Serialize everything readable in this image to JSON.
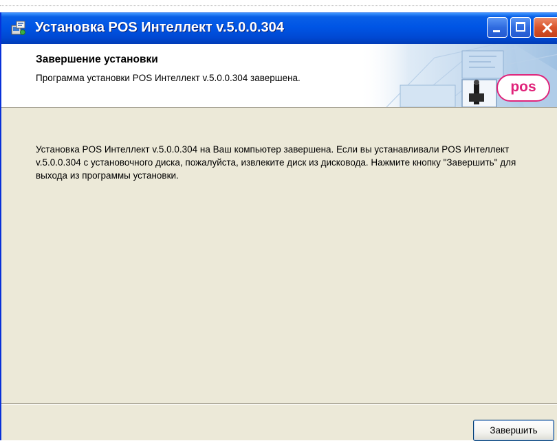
{
  "window": {
    "title": "Установка POS Интеллект v.5.0.0.304"
  },
  "header": {
    "title": "Завершение установки",
    "subtitle": "Программа установки POS Интеллект v.5.0.0.304 завершена.",
    "logo_text": "pos"
  },
  "main": {
    "message": "Установка POS Интеллект v.5.0.0.304 на Ваш компьютер завершена. Если вы устанавливали POS Интеллект v.5.0.0.304 с установочного диска, пожалуйста, извлеките диск из дисковода. Нажмите кнопку \"Завершить\" для выхода из программы установки."
  },
  "footer": {
    "finish_label": "Завершить"
  },
  "colors": {
    "titlebar": "#0055e5",
    "dialog_bg": "#ece9d8",
    "logo_accent": "#e0237a"
  },
  "icons": {
    "title_icon": "installer-icon",
    "header_art": "office-illustration"
  }
}
